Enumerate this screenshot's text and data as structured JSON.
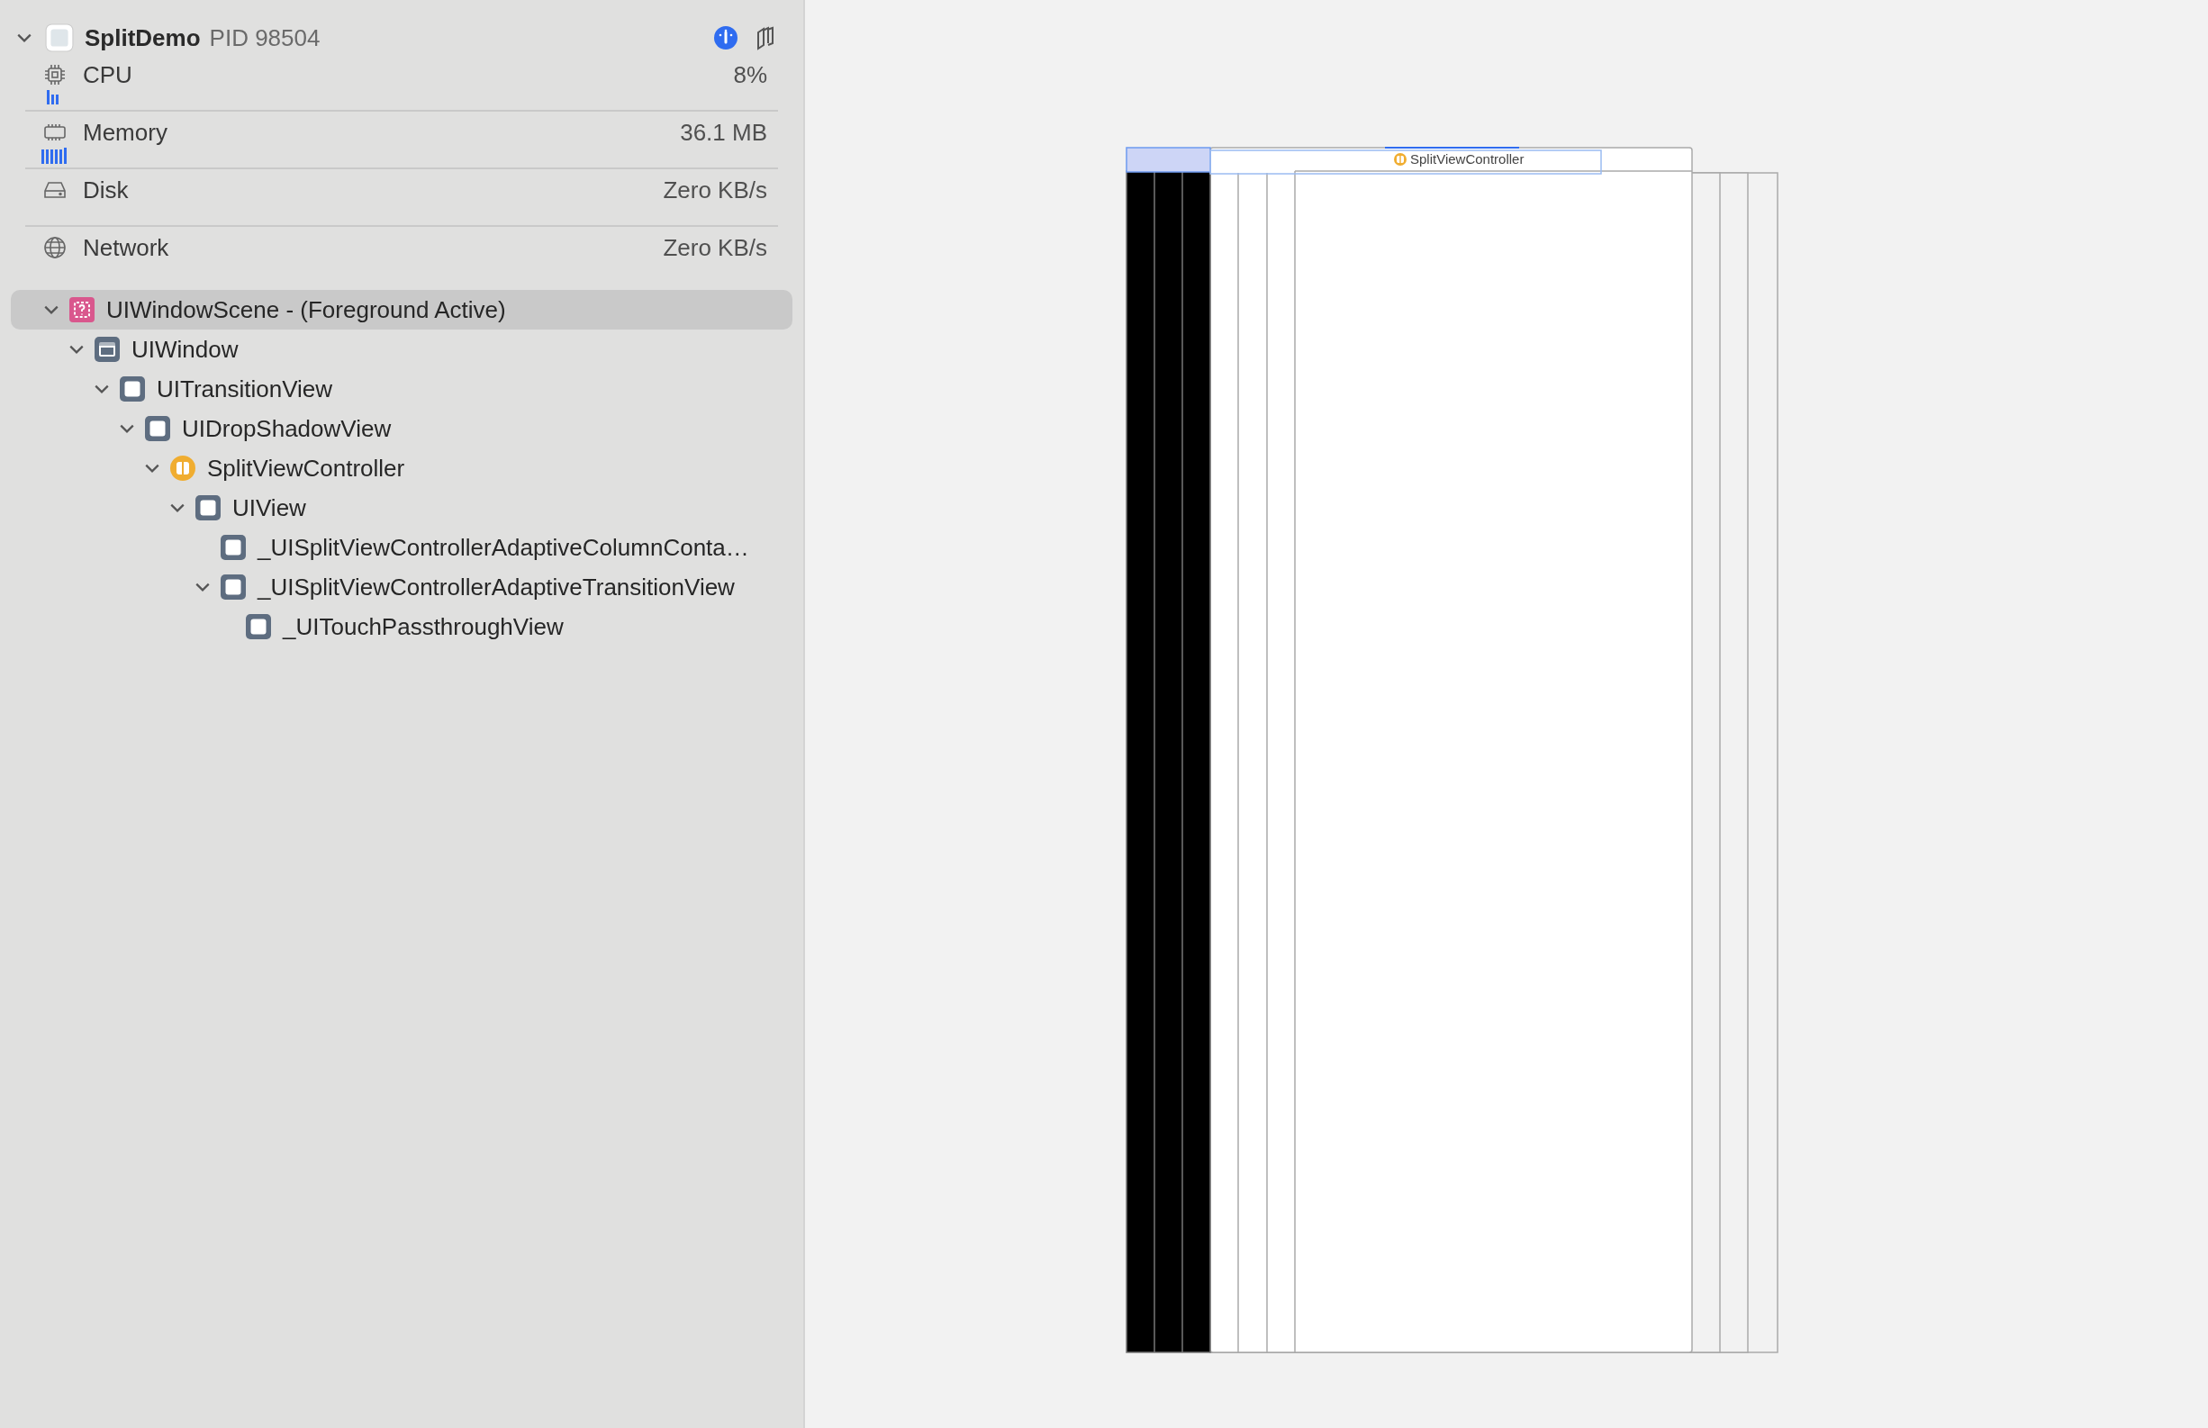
{
  "process": {
    "name": "SplitDemo",
    "pid": "PID 98504",
    "expanded": true
  },
  "metrics": [
    {
      "kind": "cpu",
      "label": "CPU",
      "value": "8%"
    },
    {
      "kind": "memory",
      "label": "Memory",
      "value": "36.1 MB"
    },
    {
      "kind": "disk",
      "label": "Disk",
      "value": "Zero KB/s"
    },
    {
      "kind": "network",
      "label": "Network",
      "value": "Zero KB/s"
    }
  ],
  "tree": [
    {
      "label": "UIWindowScene - (Foreground Active)",
      "kind": "scene",
      "selected": true,
      "expanded": true,
      "children": [
        {
          "label": "UIWindow",
          "kind": "window",
          "selected": false,
          "expanded": true,
          "children": [
            {
              "label": "UITransitionView",
              "kind": "view",
              "selected": false,
              "expanded": true,
              "children": [
                {
                  "label": "UIDropShadowView",
                  "kind": "view",
                  "selected": false,
                  "expanded": true,
                  "children": [
                    {
                      "label": "SplitViewController",
                      "kind": "controller",
                      "selected": false,
                      "expanded": true,
                      "children": [
                        {
                          "label": "UIView",
                          "kind": "view",
                          "selected": false,
                          "expanded": true,
                          "children": [
                            {
                              "label": "_UISplitViewControllerAdaptiveColumnConta…",
                              "kind": "view",
                              "selected": false
                            },
                            {
                              "label": "_UISplitViewControllerAdaptiveTransitionView",
                              "kind": "view",
                              "selected": false,
                              "expanded": true,
                              "children": [
                                {
                                  "label": "_UITouchPassthroughView",
                                  "kind": "view",
                                  "selected": false
                                }
                              ]
                            }
                          ]
                        }
                      ]
                    }
                  ]
                }
              ]
            }
          ]
        }
      ]
    }
  ],
  "canvas": {
    "label": "SplitViewController"
  }
}
